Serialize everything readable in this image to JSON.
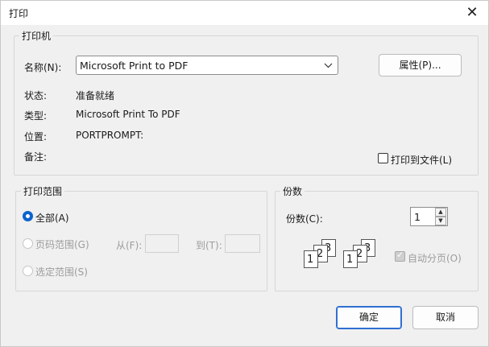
{
  "window": {
    "title": "打印",
    "close_icon": "close-icon"
  },
  "printer": {
    "legend": "打印机",
    "name_label": "名称(N):",
    "selected_printer": "Microsoft Print to PDF",
    "properties_button": "属性(P)...",
    "status_label": "状态:",
    "status_value": "准备就绪",
    "type_label": "类型:",
    "type_value": "Microsoft Print To PDF",
    "location_label": "位置:",
    "location_value": "PORTPROMPT:",
    "comment_label": "备注:",
    "print_to_file_label": "打印到文件(L)"
  },
  "print_range": {
    "legend": "打印范围",
    "all_label": "全部(A)",
    "pages_label": "页码范围(G)",
    "from_label": "从(F):",
    "to_label": "到(T):",
    "selection_label": "选定范围(S)"
  },
  "copies": {
    "legend": "份数",
    "copies_label": "份数(C):",
    "copies_value": "1",
    "collate_label": "自动分页(O)"
  },
  "actions": {
    "ok_label": "确定",
    "cancel_label": "取消"
  }
}
